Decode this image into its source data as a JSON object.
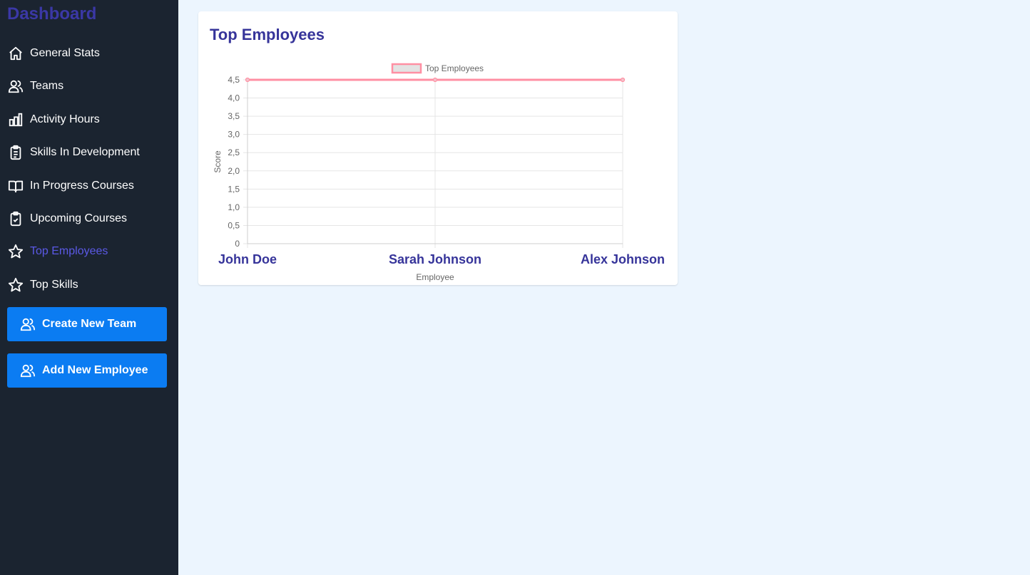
{
  "sidebar": {
    "title": "Dashboard",
    "items": [
      {
        "label": "General Stats",
        "icon": "home-icon"
      },
      {
        "label": "Teams",
        "icon": "users-icon"
      },
      {
        "label": "Activity Hours",
        "icon": "bar-chart-icon"
      },
      {
        "label": "Skills In Development",
        "icon": "clipboard-list-icon"
      },
      {
        "label": "In Progress Courses",
        "icon": "book-open-icon"
      },
      {
        "label": "Upcoming Courses",
        "icon": "clipboard-check-icon"
      },
      {
        "label": "Top Employees",
        "icon": "star-icon",
        "active": true
      },
      {
        "label": "Top Skills",
        "icon": "star-icon"
      }
    ],
    "buttons": [
      {
        "label": "Create New Team",
        "icon": "users-icon"
      },
      {
        "label": "Add New Employee",
        "icon": "users-icon"
      }
    ]
  },
  "main": {
    "card_title": "Top Employees"
  },
  "colors": {
    "sidebar_bg": "#1b2430",
    "accent": "#0b7cf2",
    "active_item": "#5b59e6",
    "title": "#36349a",
    "series_line": "#ff8fa3"
  },
  "chart_data": {
    "type": "line",
    "title": "",
    "legend": "Top Employees",
    "legend_position": "top",
    "categories": [
      "John Doe",
      "Sarah Johnson",
      "Alex Johnson"
    ],
    "series": [
      {
        "name": "Top Employees",
        "values": [
          4.5,
          4.5,
          4.5
        ]
      }
    ],
    "xlabel": "Employee",
    "ylabel": "Score",
    "ylim": [
      0,
      4.5
    ],
    "yticks": [
      "0",
      "0,5",
      "1,0",
      "1,5",
      "2,0",
      "2,5",
      "3,0",
      "3,5",
      "4,0",
      "4,5"
    ],
    "grid": true
  }
}
